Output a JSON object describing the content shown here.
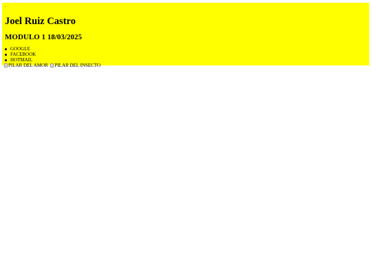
{
  "page": {
    "background_color": "#ffff00"
  },
  "header": {
    "name": "Joel Ruiz Castro",
    "module": "MODULO 1 18/03/2025"
  },
  "links": [
    {
      "label": "GOOGLE"
    },
    {
      "label": "FACEBOOK"
    },
    {
      "label": "HOTMAIL"
    }
  ],
  "images": [
    {
      "alt": "PILAR DEL AMOR",
      "icon": "broken-image-icon"
    },
    {
      "alt": "PILAR DEL INSECTO",
      "icon": "broken-image-icon"
    }
  ]
}
